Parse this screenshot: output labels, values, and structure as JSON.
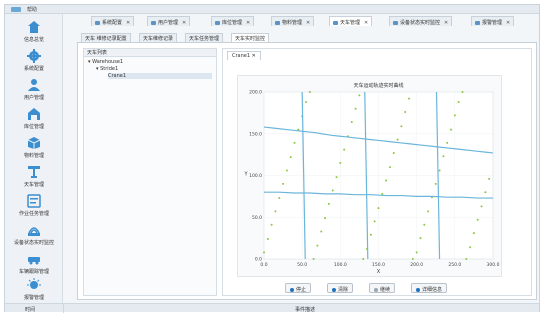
{
  "window": {
    "title": "帮助"
  },
  "sidebar": {
    "items": [
      {
        "label": "信息总览",
        "icon": "home-icon"
      },
      {
        "label": "系统配置",
        "icon": "gear-icon"
      },
      {
        "label": "用户管理",
        "icon": "user-icon"
      },
      {
        "label": "库位管理",
        "icon": "warehouse-icon"
      },
      {
        "label": "物料管理",
        "icon": "box-icon"
      },
      {
        "label": "天车管理",
        "icon": "crane-icon"
      },
      {
        "label": "作业任务管理",
        "icon": "task-icon"
      },
      {
        "label": "设备状态实时监控",
        "icon": "monitor-icon"
      },
      {
        "label": "车辆跟踪管理",
        "icon": "vehicle-icon"
      },
      {
        "label": "报警管理",
        "icon": "alarm-icon"
      }
    ]
  },
  "tabs": [
    {
      "label": "系统配置"
    },
    {
      "label": "用户管理"
    },
    {
      "label": "库位管理"
    },
    {
      "label": "物料管理"
    },
    {
      "label": "天车管理"
    },
    {
      "label": "设备状态实时监控"
    },
    {
      "label": "报警管理"
    }
  ],
  "subtabs": [
    {
      "label": "天车 维修记录配置"
    },
    {
      "label": "天车维修记录"
    },
    {
      "label": "天车任务管理"
    },
    {
      "label": "天车实时监控"
    }
  ],
  "tree": {
    "header": "天车列表",
    "nodes": [
      {
        "label": "Warehouse1"
      },
      {
        "label": "Stride1"
      },
      {
        "label": "Crane1"
      }
    ]
  },
  "chart_tab": {
    "label": "Crane1"
  },
  "chart_data": {
    "type": "line",
    "title": "天车运动轨迹实时曲线",
    "xlabel": "X",
    "ylabel": "Y",
    "xlim": [
      0,
      300
    ],
    "ylim": [
      0,
      200
    ],
    "xticks": [
      "0.0",
      "50.0",
      "100.0",
      "150.0",
      "200.0",
      "250.0",
      "300.0"
    ],
    "yticks": [
      "0.0",
      "50.0",
      "100.0",
      "150.0",
      "200.0"
    ],
    "grid": true,
    "series": [
      {
        "style": "markers",
        "color": "#8dc63f",
        "x": [
          0,
          5,
          10,
          15,
          20,
          25,
          30,
          35,
          40,
          45,
          50,
          55,
          60,
          65,
          70,
          75,
          80,
          85,
          90,
          95,
          100,
          105,
          110,
          115,
          120,
          125,
          130,
          135,
          140,
          145,
          150,
          155,
          160,
          165,
          170,
          175,
          180,
          185,
          190,
          195,
          200,
          205,
          210,
          215,
          220,
          225,
          230,
          235,
          240,
          245,
          250,
          255,
          260,
          265,
          270,
          275,
          280,
          285,
          290,
          295
        ],
        "y": [
          8,
          24,
          41,
          57,
          73,
          90,
          106,
          122,
          139,
          155,
          171,
          188,
          200,
          0,
          16,
          33,
          49,
          66,
          82,
          98,
          115,
          131,
          147,
          164,
          180,
          196,
          0,
          12,
          29,
          45,
          61,
          78,
          94,
          110,
          127,
          143,
          159,
          176,
          192,
          0,
          8,
          25,
          41,
          57,
          74,
          90,
          106,
          123,
          139,
          155,
          172,
          188,
          200,
          0,
          14,
          31,
          47,
          63,
          80,
          96
        ]
      },
      {
        "style": "line",
        "color": "#6bb6dc",
        "x": [
          0,
          10,
          20,
          30,
          40,
          50,
          60,
          70,
          75,
          82,
          90,
          100,
          110,
          120,
          130,
          140,
          150,
          160,
          170,
          180,
          190,
          200,
          210,
          220,
          230,
          240,
          250,
          260,
          270,
          280,
          290,
          300
        ],
        "y": [
          158,
          157,
          156,
          155,
          154,
          153,
          152,
          151,
          150,
          149,
          148,
          147,
          146,
          145,
          144,
          143,
          142,
          141,
          140,
          139,
          138,
          137,
          136,
          135,
          134,
          133,
          132,
          131,
          130,
          129,
          128,
          127
        ]
      },
      {
        "style": "line",
        "color": "#6bb6dc",
        "x": [
          0,
          20,
          40,
          60,
          80,
          100,
          120,
          140,
          160,
          180,
          200,
          220,
          240,
          260,
          280,
          300
        ],
        "y": [
          80,
          80,
          79,
          79,
          78,
          78,
          77,
          77,
          76,
          76,
          75,
          75,
          74,
          74,
          73,
          73
        ]
      },
      {
        "style": "line",
        "color": "#6bb6dc",
        "x": [
          50,
          51,
          52,
          53,
          54
        ],
        "y": [
          200,
          150,
          100,
          50,
          0
        ]
      },
      {
        "style": "line",
        "color": "#6bb6dc",
        "x": [
          132,
          133,
          134,
          135,
          136
        ],
        "y": [
          200,
          150,
          100,
          50,
          0
        ]
      },
      {
        "style": "line",
        "color": "#6bb6dc",
        "x": [
          226,
          227,
          228,
          229,
          230
        ],
        "y": [
          200,
          150,
          100,
          50,
          0
        ]
      }
    ]
  },
  "buttons": [
    {
      "label": "停止",
      "color": "#1e73be"
    },
    {
      "label": "清除",
      "color": "#1e73be"
    },
    {
      "label": "继续",
      "color": "#9aa5b1"
    },
    {
      "label": "详细信息",
      "color": "#1e73be"
    }
  ],
  "status": {
    "left": "时间",
    "middle": "事件描述"
  }
}
